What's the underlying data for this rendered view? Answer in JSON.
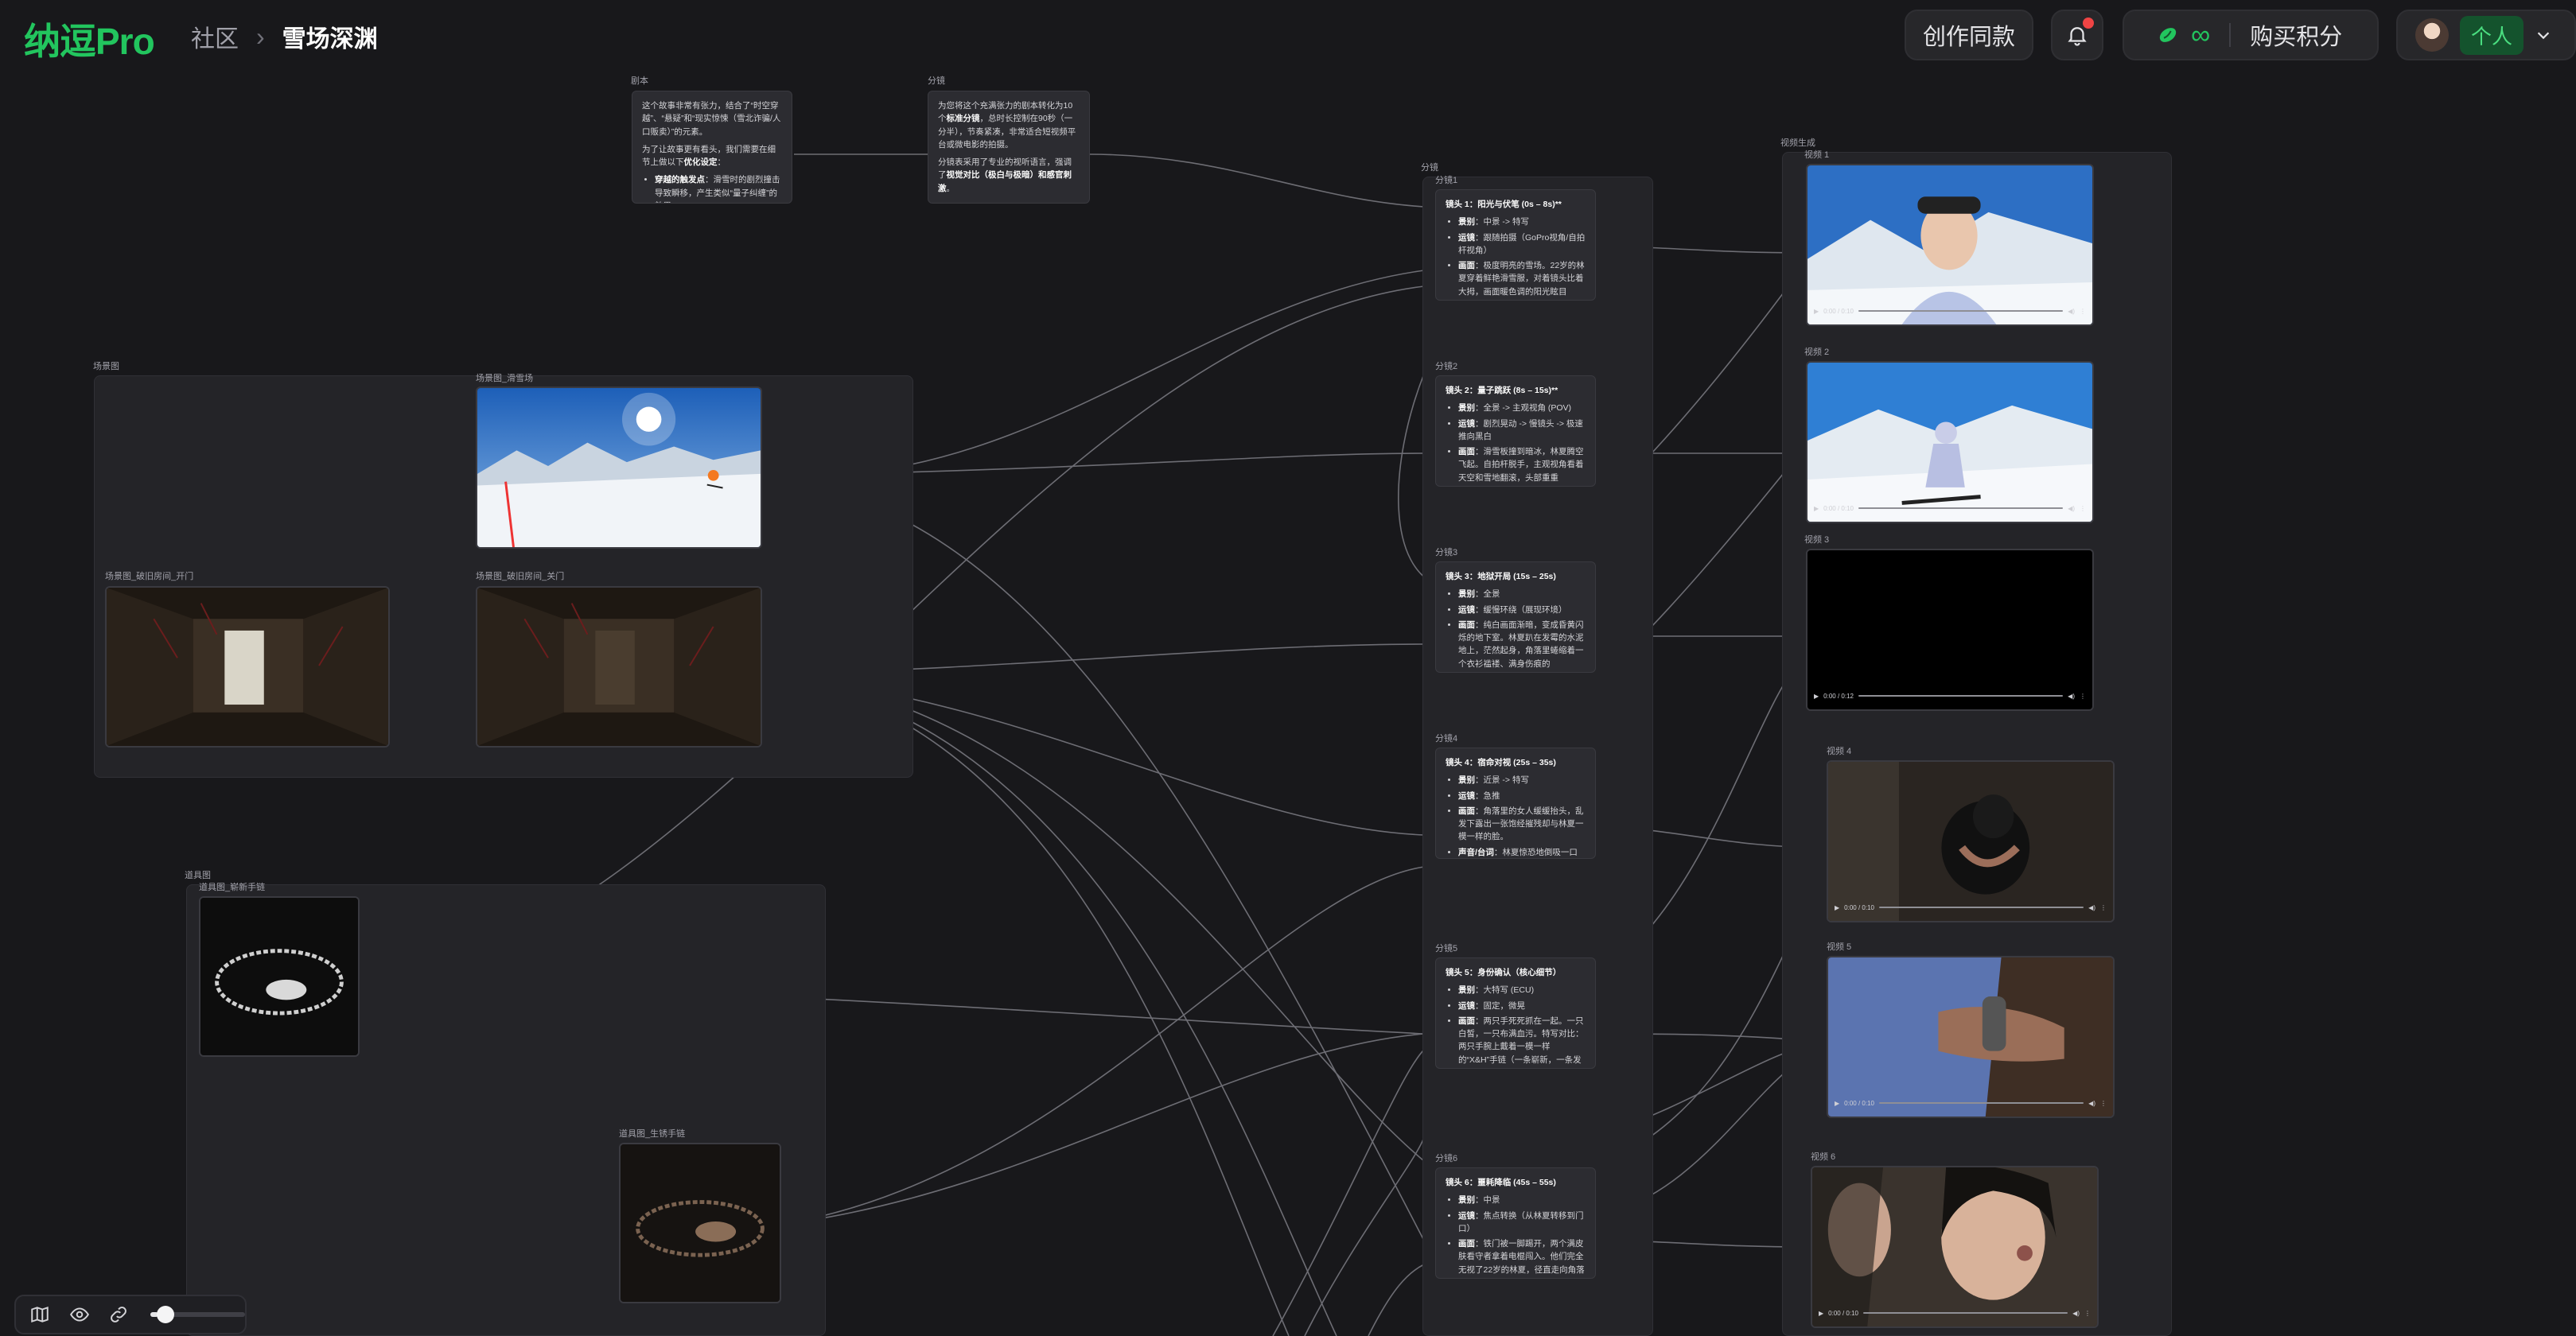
{
  "app": {
    "logo": "纳逗Pro"
  },
  "breadcrumb": {
    "root": "社区",
    "separator": "›",
    "current": "雪场深渊"
  },
  "header": {
    "create_same": "创作同款",
    "infinity": "∞",
    "buy_points": "购买积分",
    "personal": "个人"
  },
  "groups": {
    "script_label": "剧本",
    "storyboard_top_label": "分镜",
    "scene_label": "场景图",
    "props_label": "道具图",
    "storyboard_label": "分镜",
    "video_gen_label": "视频生成"
  },
  "script_card": {
    "p1": "这个故事非常有张力，结合了“时空穿越”、“悬疑”和“现实惊悚（雪北诈骗/人口贩卖）”的元素。",
    "p2_a": "为了让故事更有看头，我们需要在细节上做以下",
    "p2_b": "优化设定",
    "p2_c": "：",
    "item1_a": "穿越的触发点",
    "item1_b": "：滑雪时的剧烈撞击导致瞬移，产生类似“量子纠缠”的效果。"
  },
  "storyboard_top_card": {
    "p1_a": "为您将这个充满张力的剧本转化为10个",
    "p1_b": "标准分镜",
    "p1_c": "，总时长控制在90秒（一分半），节奏紧凑，非常适合短视频平台或微电影的拍摄。",
    "p2_a": "分镜表采用了专业的视听语言，强调了",
    "p2_b": "视觉对比（极白与极暗）和感官刺激",
    "p2_c": "。"
  },
  "scenes": {
    "ski": "场景图_滑雪场",
    "room_open": "场景图_破旧房间_开门",
    "room_closed": "场景图_破旧房间_关门"
  },
  "props": {
    "new": "道具图_崭新手链",
    "rusty": "道具图_生锈手链"
  },
  "shots": [
    {
      "label": "分镜1",
      "title": "镜头 1：阳光与伏笔 (0s – 8s)**",
      "items": [
        {
          "k": "景别",
          "v": "中景 -> 特写"
        },
        {
          "k": "运镜",
          "v": "跟随拍摄（GoPro视角/自拍杆视角）"
        },
        {
          "k": "画面",
          "v": "极度明亮的雪场。22岁的林夏穿着鲜艳滑雪服，对着镜头比着大拇，画面暖色调的阳光眩目"
        }
      ]
    },
    {
      "label": "分镜2",
      "title": "镜头 2：量子跳跃 (8s – 15s)**",
      "items": [
        {
          "k": "景别",
          "v": "全景 -> 主观视角 (POV)"
        },
        {
          "k": "运镜",
          "v": "剧烈晃动 -> 慢镜头 -> 极速推向黑白"
        },
        {
          "k": "画面",
          "v": "滑雪板撞到暗冰，林夏腾空飞起。自拍杆脱手，主观视角看着天空和雪地翻滚，头部重重"
        }
      ]
    },
    {
      "label": "分镜3",
      "title": "镜头 3：地狱开局 (15s – 25s)",
      "items": [
        {
          "k": "景别",
          "v": "全景"
        },
        {
          "k": "运镜",
          "v": "缓慢环绕（展现环境）"
        },
        {
          "k": "画面",
          "v": "纯白画面渐暗，变成昏黄闪烁的地下室。林夏趴在发霉的水泥地上，茫然起身，角落里蜷缩着一个衣衫褴褛、满身伤痕的"
        }
      ]
    },
    {
      "label": "分镜4",
      "title": "镜头 4：宿命对视 (25s – 35s)",
      "items": [
        {
          "k": "景别",
          "v": "近景 -> 特写"
        },
        {
          "k": "运镜",
          "v": "急推"
        },
        {
          "k": "画面",
          "v": "角落里的女人缓缓抬头，乱发下露出一张饱经摧残却与林夏一模一样的脸。"
        },
        {
          "k": "声音/台词",
          "v": "林夏惊恐地倒吸一口冷气"
        }
      ]
    },
    {
      "label": "分镜5",
      "title": "镜头 5：身份确认（核心细节）",
      "items": [
        {
          "k": "景别",
          "v": "大特写 (ECU)"
        },
        {
          "k": "运镜",
          "v": "固定，微晃"
        },
        {
          "k": "画面",
          "v": "两只手死死抓在一起。一只白皙，一只布满血污。特写对比：两只手腕上戴着一模一样的“X&H”手链（一条崭新，一条发黑生锈）"
        }
      ]
    },
    {
      "label": "分镜6",
      "title": "镜头 6：噩耗降临 (45s – 55s)",
      "items": [
        {
          "k": "景别",
          "v": "中景"
        },
        {
          "k": "运镜",
          "v": "焦点转换（从林夏转移到门口）"
        },
        {
          "k": "画面",
          "v": "铁门被一脚踢开，两个满皮肤看守者拿着电棍闯入。他们完全无视了22岁的林夏，径直走向角落"
        }
      ]
    }
  ],
  "videos": [
    {
      "label": "视频 1",
      "time": "0:00 / 0:10"
    },
    {
      "label": "视频 2",
      "time": "0:00 / 0:10"
    },
    {
      "label": "视频 3",
      "time": "0:00 / 0:12"
    },
    {
      "label": "视频 4",
      "time": "0:00 / 0:10"
    },
    {
      "label": "视频 5",
      "time": "0:00 / 0:10"
    },
    {
      "label": "视频 6",
      "time": "0:00 / 0:10"
    }
  ],
  "toolbar": {
    "zoom_fraction": 0.08
  },
  "colors": {
    "brand": "#22c55e",
    "background": "#18181b",
    "node": "#2c2c31",
    "wire": "#8a8a92",
    "notification": "#ef4444"
  },
  "icons": [
    "bell-icon",
    "bean-icon",
    "chevron-down-icon",
    "map-icon",
    "eye-icon",
    "link-icon",
    "play-icon",
    "volume-icon"
  ]
}
